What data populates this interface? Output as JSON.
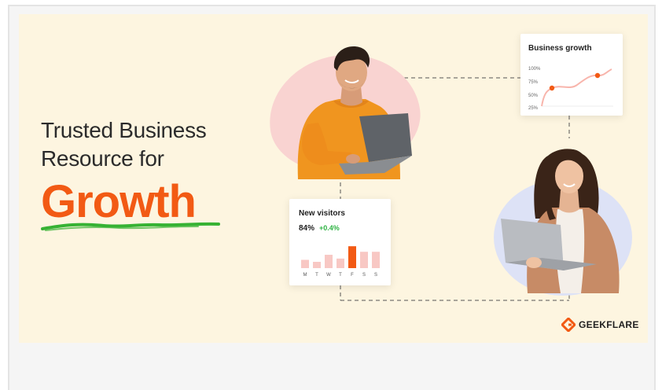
{
  "headline": {
    "line1": "Trusted Business",
    "line2": "Resource for",
    "highlight": "Growth"
  },
  "business_growth_card": {
    "title": "Business growth",
    "y_ticks": [
      "100%",
      "75%",
      "50%",
      "25%"
    ]
  },
  "new_visitors_card": {
    "title": "New visitors",
    "value": "84%",
    "change": "+0.4%",
    "days": [
      "M",
      "T",
      "W",
      "T",
      "F",
      "S",
      "S"
    ],
    "bar_levels": [
      0.33,
      0.25,
      0.53,
      0.38,
      0.87,
      0.65,
      0.65
    ],
    "highlight_index": 4
  },
  "brand": {
    "name": "GEEKFLARE",
    "logo_icon": "geekflare-logo-icon"
  },
  "colors": {
    "accent": "#f25a14",
    "banner_bg": "#fdf5e0",
    "squiggle": "#36b233",
    "bar_light": "#f8c8c4",
    "bar_active": "#f25a14",
    "positive": "#2fb344"
  }
}
